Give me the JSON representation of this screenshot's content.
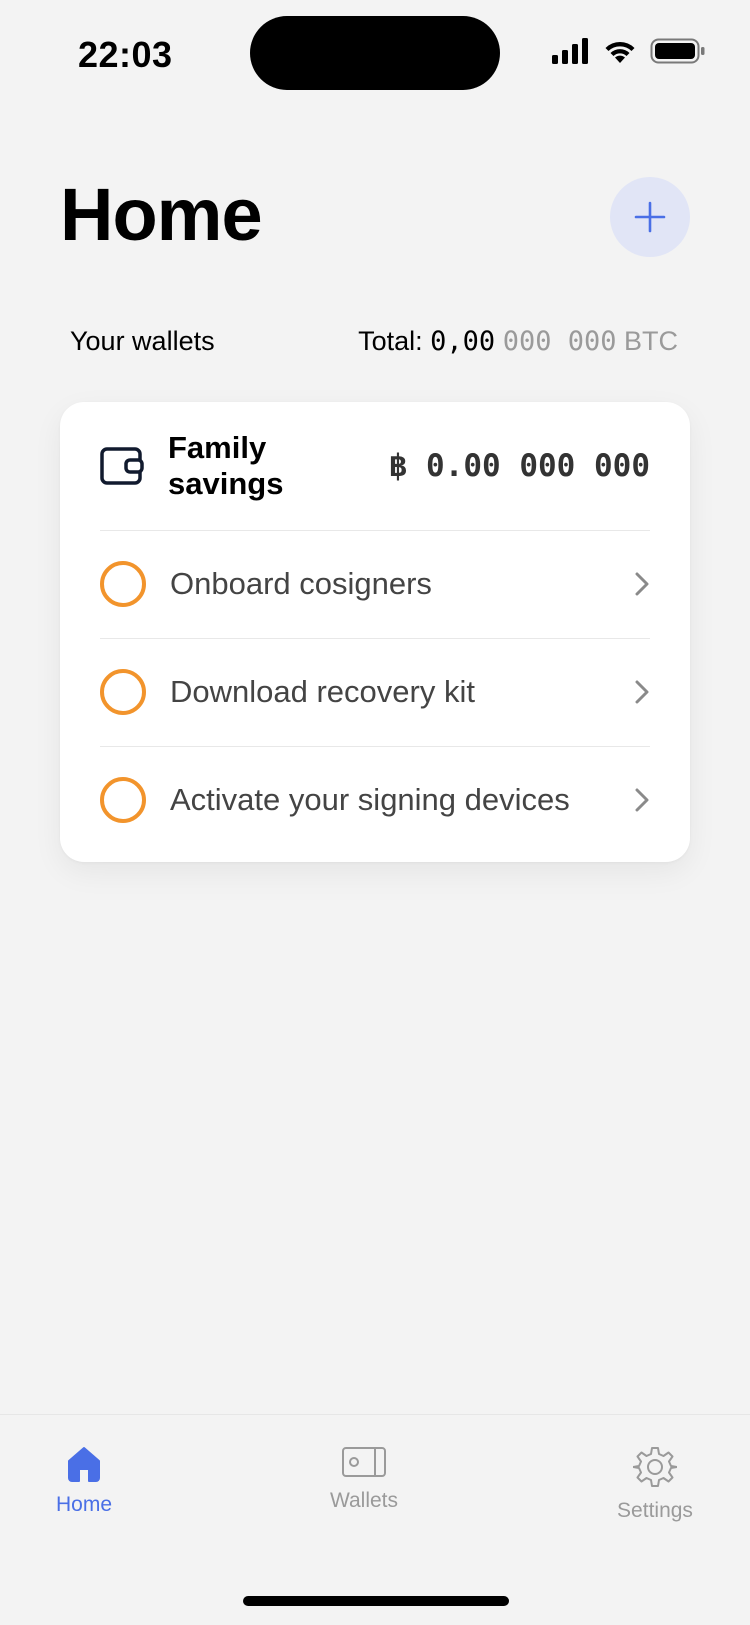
{
  "status_bar": {
    "time": "22:03"
  },
  "header": {
    "title": "Home",
    "add_button_icon": "plus-icon"
  },
  "wallets_section": {
    "label": "Your wallets",
    "total_prefix": "Total:",
    "total_value_main": "0,00",
    "total_value_dim": "000 000",
    "total_unit": "BTC"
  },
  "wallet_card": {
    "name": "Family savings",
    "balance": "฿ 0.00 000 000",
    "icon": "wallet-icon",
    "tasks": [
      {
        "label": "Onboard cosigners"
      },
      {
        "label": "Download recovery kit"
      },
      {
        "label": "Activate your signing devices"
      }
    ]
  },
  "tab_bar": {
    "tabs": [
      {
        "label": "Home",
        "icon": "home-icon",
        "active": true
      },
      {
        "label": "Wallets",
        "icon": "wallet-icon",
        "active": false
      },
      {
        "label": "Settings",
        "icon": "gear-icon",
        "active": false
      }
    ]
  },
  "colors": {
    "accent": "#4a6fe6",
    "task_ring": "#f2942c",
    "background": "#f3f3f3"
  }
}
